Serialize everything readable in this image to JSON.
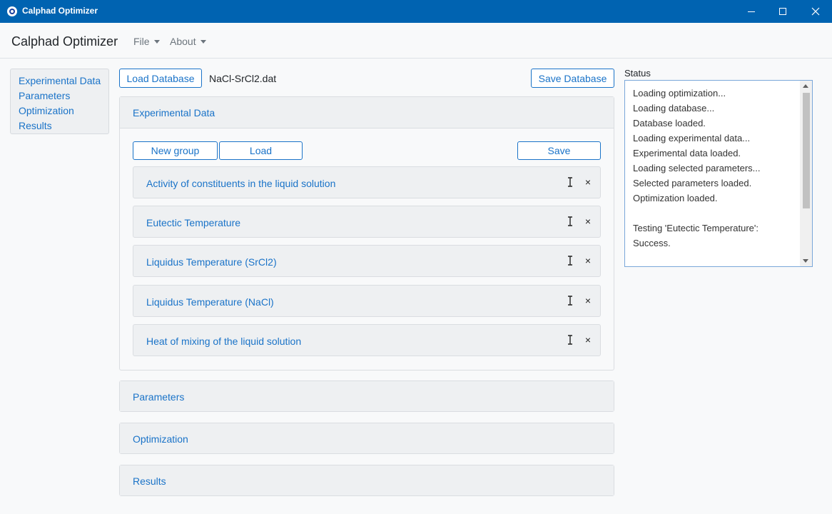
{
  "window": {
    "title": "Calphad Optimizer",
    "icon": "app-logo-icon",
    "titlebar_color": "#0063b1"
  },
  "navbar": {
    "brand": "Calphad Optimizer",
    "menus": [
      {
        "label": "File"
      },
      {
        "label": "About"
      }
    ]
  },
  "sidebar": {
    "items": [
      {
        "label": "Experimental Data"
      },
      {
        "label": "Parameters"
      },
      {
        "label": "Optimization"
      },
      {
        "label": "Results"
      }
    ]
  },
  "toolbar": {
    "load_database_label": "Load Database",
    "database_filename": "NaCl-SrCl2.dat",
    "save_database_label": "Save Database"
  },
  "sections": {
    "experimental": {
      "header": "Experimental Data",
      "new_group_label": "New group",
      "load_label": "Load",
      "save_label": "Save",
      "groups": [
        {
          "label": "Activity of constituents in the liquid solution"
        },
        {
          "label": "Eutectic Temperature"
        },
        {
          "label": "Liquidus Temperature (SrCl2)"
        },
        {
          "label": "Liquidus Temperature (NaCl)"
        },
        {
          "label": "Heat of mixing of the liquid solution"
        }
      ],
      "group_actions": {
        "rename_icon": "text-cursor-icon",
        "remove_symbol": "×"
      }
    },
    "parameters": {
      "header": "Parameters"
    },
    "optimization": {
      "header": "Optimization"
    },
    "results": {
      "header": "Results"
    }
  },
  "status": {
    "label": "Status",
    "lines": [
      "Loading optimization...",
      "Loading database...",
      "Database loaded.",
      "Loading experimental data...",
      "Experimental data loaded.",
      "Loading selected parameters...",
      "Selected parameters loaded.",
      "Optimization loaded.",
      "",
      "Testing 'Eutectic Temperature':",
      "Success."
    ]
  },
  "colors": {
    "accent": "#1a73c8",
    "background": "#f8f9fa",
    "card_header": "#eef0f2"
  }
}
